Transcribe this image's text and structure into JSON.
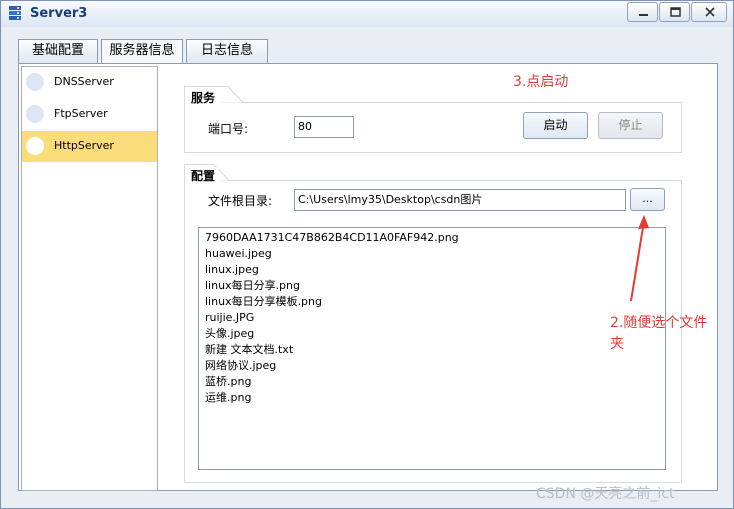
{
  "window": {
    "title": "Server3"
  },
  "tabs": [
    {
      "label": "基础配置"
    },
    {
      "label": "服务器信息"
    },
    {
      "label": "日志信息"
    }
  ],
  "sidebar": {
    "items": [
      {
        "label": "DNSServer"
      },
      {
        "label": "FtpServer"
      },
      {
        "label": "HttpServer"
      }
    ]
  },
  "service": {
    "group_title": "服务",
    "port_label": "端口号:",
    "port_value": "80",
    "start_label": "启动",
    "stop_label": "停止"
  },
  "config": {
    "group_title": "配置",
    "root_label": "文件根目录:",
    "root_value": "C:\\Users\\lmy35\\Desktop\\csdn图片",
    "browse_label": "..."
  },
  "files": [
    "7960DAA1731C47B862B4CD11A0FAF942.png",
    "huawei.jpeg",
    "linux.jpeg",
    "linux每日分享.png",
    "linux每日分享模板.png",
    "ruijie.JPG",
    "头像.jpeg",
    "新建 文本文档.txt",
    "网络协议.jpeg",
    "蓝桥.png",
    "运维.png"
  ],
  "annotations": {
    "step3": "3.点启动",
    "step2_line1": "2.随便选个文件",
    "step2_line2": "夹"
  },
  "watermark": "CSDN @天亮之前_ict",
  "colors": {
    "annotation": "#e53935",
    "selected_item": "#fbdc7a"
  }
}
